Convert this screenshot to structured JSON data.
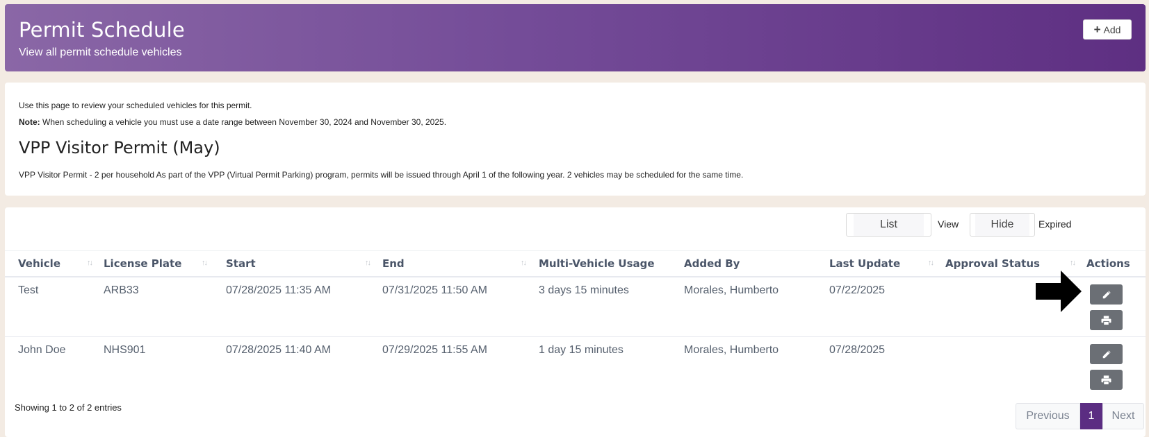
{
  "header": {
    "title": "Permit Schedule",
    "subtitle": "View all permit schedule vehicles",
    "add_label": "Add"
  },
  "info": {
    "line1": "Use this page to review your scheduled vehicles for this permit.",
    "note_label": "Note:",
    "note_text": " When scheduling a vehicle you must use a date range between November 30, 2024 and November 30, 2025.",
    "permit_title": "VPP Visitor Permit (May)",
    "description": "VPP Visitor Permit - 2 per household As part of the VPP (Virtual Permit Parking) program, permits will be issued through April 1 of the following year. 2 vehicles may be scheduled for the same time."
  },
  "controls": {
    "list_label": "List",
    "view_label": "View",
    "hide_label": "Hide",
    "expired_label": "Expired"
  },
  "table": {
    "columns": [
      "Vehicle",
      "License Plate",
      "Start",
      "End",
      "Multi-Vehicle Usage",
      "Added By",
      "Last Update",
      "Approval Status",
      "Actions"
    ],
    "rows": [
      {
        "vehicle": "Test",
        "plate": "ARB33",
        "start": "07/28/2025 11:35 AM",
        "end": "07/31/2025 11:50 AM",
        "usage": "3 days 15 minutes",
        "added_by": "Morales, Humberto",
        "last_update": "07/22/2025",
        "approval": ""
      },
      {
        "vehicle": "John Doe",
        "plate": "NHS901",
        "start": "07/28/2025 11:40 AM",
        "end": "07/29/2025 11:55 AM",
        "usage": "1 day 15 minutes",
        "added_by": "Morales, Humberto",
        "last_update": "07/28/2025",
        "approval": ""
      }
    ]
  },
  "footer": {
    "showing": "Showing 1 to 2 of 2 entries",
    "previous": "Previous",
    "current_page": "1",
    "next": "Next"
  },
  "icons": {
    "edit": "pencil-icon",
    "print": "printer-icon",
    "pointer": "arrow-right-icon"
  }
}
